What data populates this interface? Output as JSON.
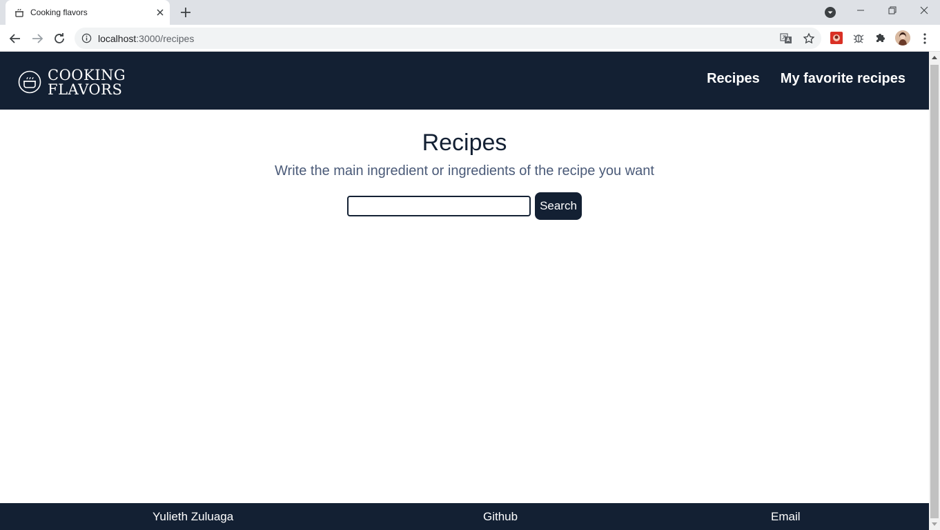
{
  "browser": {
    "tab_title": "Cooking flavors",
    "url_host": "localhost",
    "url_rest": ":3000/recipes"
  },
  "site": {
    "logo_line1": "COOKING",
    "logo_line2": "FLAVORS",
    "nav": [
      {
        "label": "Recipes"
      },
      {
        "label": "My favorite recipes"
      }
    ]
  },
  "main": {
    "title": "Recipes",
    "subtitle": "Write the main ingredient or ingredients of the recipe you want",
    "search_value": "",
    "search_button": "Search"
  },
  "footer": {
    "name": "Yulieth Zuluaga",
    "github": "Github",
    "email": "Email"
  },
  "colors": {
    "header_bg": "#132033",
    "footer_bg": "#132033",
    "button_bg": "#132033",
    "subtitle": "#4a5a78"
  }
}
